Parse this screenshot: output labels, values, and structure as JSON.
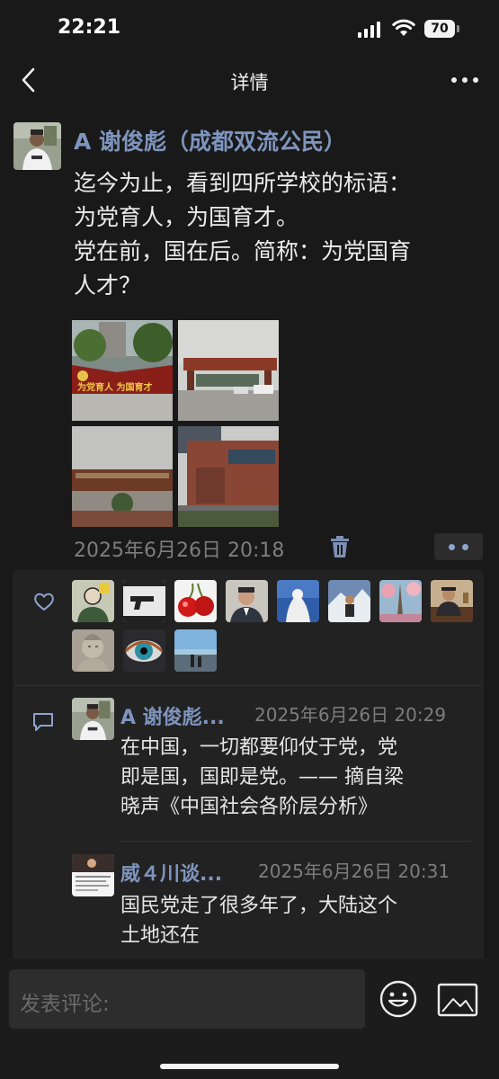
{
  "status": {
    "time": "22:21",
    "battery": "70"
  },
  "nav": {
    "title": "详情"
  },
  "post": {
    "author": "A 谢俊彪（成都双流公民）",
    "lines": [
      "迄今为止，看到四所学校的标语：",
      "为党育人，为国育才。",
      "党在前，国在后。简称：为党国育",
      "人才？"
    ],
    "photo_text": "为党育人 为国育才",
    "time": "2025年6月26日 20:18"
  },
  "likes": {
    "count": 12
  },
  "comments": [
    {
      "author": "A 谢俊彪...",
      "time": "2025年6月26日 20:29",
      "lines": [
        "在中国，一切都要仰仗于党，党",
        "即是国，国即是党。—— 摘自梁",
        "晓声《中国社会各阶层分析》"
      ]
    },
    {
      "author": "威４川谈...",
      "time": "2025年6月26日 20:31",
      "lines": [
        "国民党走了很多年了，大陆这个",
        "土地还在"
      ]
    }
  ],
  "composer": {
    "placeholder": "发表评论:"
  },
  "colors": {
    "link": "#7e95bd",
    "background": "#191919",
    "panel": "#222222"
  }
}
